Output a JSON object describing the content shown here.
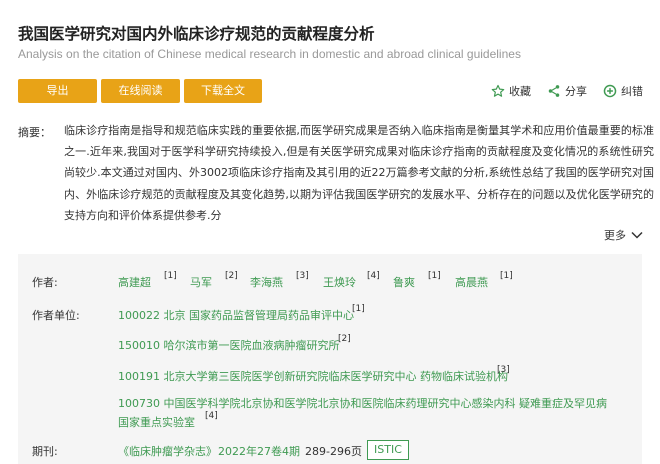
{
  "article": {
    "title": "我国医学研究对国内外临床诊疗规范的贡献程度分析",
    "subtitle": "Analysis on the citation of Chinese medical research in domestic and abroad clinical guidelines"
  },
  "buttons": {
    "export": "导出",
    "online_read": "在线阅读",
    "download": "下载全文"
  },
  "actions": {
    "favorite": "收藏",
    "share": "分享",
    "correct": "纠错"
  },
  "abstract": {
    "label": "摘要：",
    "text": "临床诊疗指南是指导和规范临床实践的重要依据,而医学研究成果是否纳入临床指南是衡量其学术和应用价值最重要的标准之一.近年来,我国对于医学科学研究持续投入,但是有关医学研究成果对临床诊疗指南的贡献程度及变化情况的系统性研究尚较少.本文通过对国内、外3002项临床诊疗指南及其引用的近22万篇参考文献的分析,系统性总结了我国的医学研究对国内、外临床诊疗规范的贡献程度及其变化趋势,以期为评估我国医学研究的发展水平、分析存在的问题以及优化医学研究的支持方向和评价体系提供参考.分",
    "more": "更多"
  },
  "info": {
    "authors_label": "作者:",
    "authors": [
      {
        "name": "高建超",
        "ref": "[1]"
      },
      {
        "name": "马军",
        "ref": "[2]"
      },
      {
        "name": "李海燕",
        "ref": "[3]"
      },
      {
        "name": "王焕玲",
        "ref": "[4]"
      },
      {
        "name": "鲁爽",
        "ref": "[1]"
      },
      {
        "name": "高晨燕",
        "ref": "[1]"
      }
    ],
    "units_label": "作者单位:",
    "units": [
      {
        "text": "100022 北京 国家药品监督管理局药品审评中心",
        "ref": "[1]"
      },
      {
        "text": "150010 哈尔滨市第一医院血液病肿瘤研究所",
        "ref": "[2]"
      },
      {
        "text": "100191 北京大学第三医院医学创新研究院临床医学研究中心 药物临床试验机构",
        "ref": "[3]"
      },
      {
        "line1": "100730 中国医学科学院北京协和医学院北京协和医院临床药理研究中心感染内科 疑难重症及罕见病",
        "line2": "国家重点实验室",
        "ref": "[4]"
      }
    ],
    "journal_label": "期刊:",
    "journal_name": "《临床肿瘤学杂志》",
    "issue": "2022年27卷4期",
    "pages": "289-296页",
    "index_badge": "ISTIC"
  },
  "colors": {
    "accent": "#e8a317",
    "link": "#3f9a52"
  },
  "icons": [
    "star-icon",
    "share-icon",
    "correct-icon",
    "chevron-down-icon"
  ]
}
